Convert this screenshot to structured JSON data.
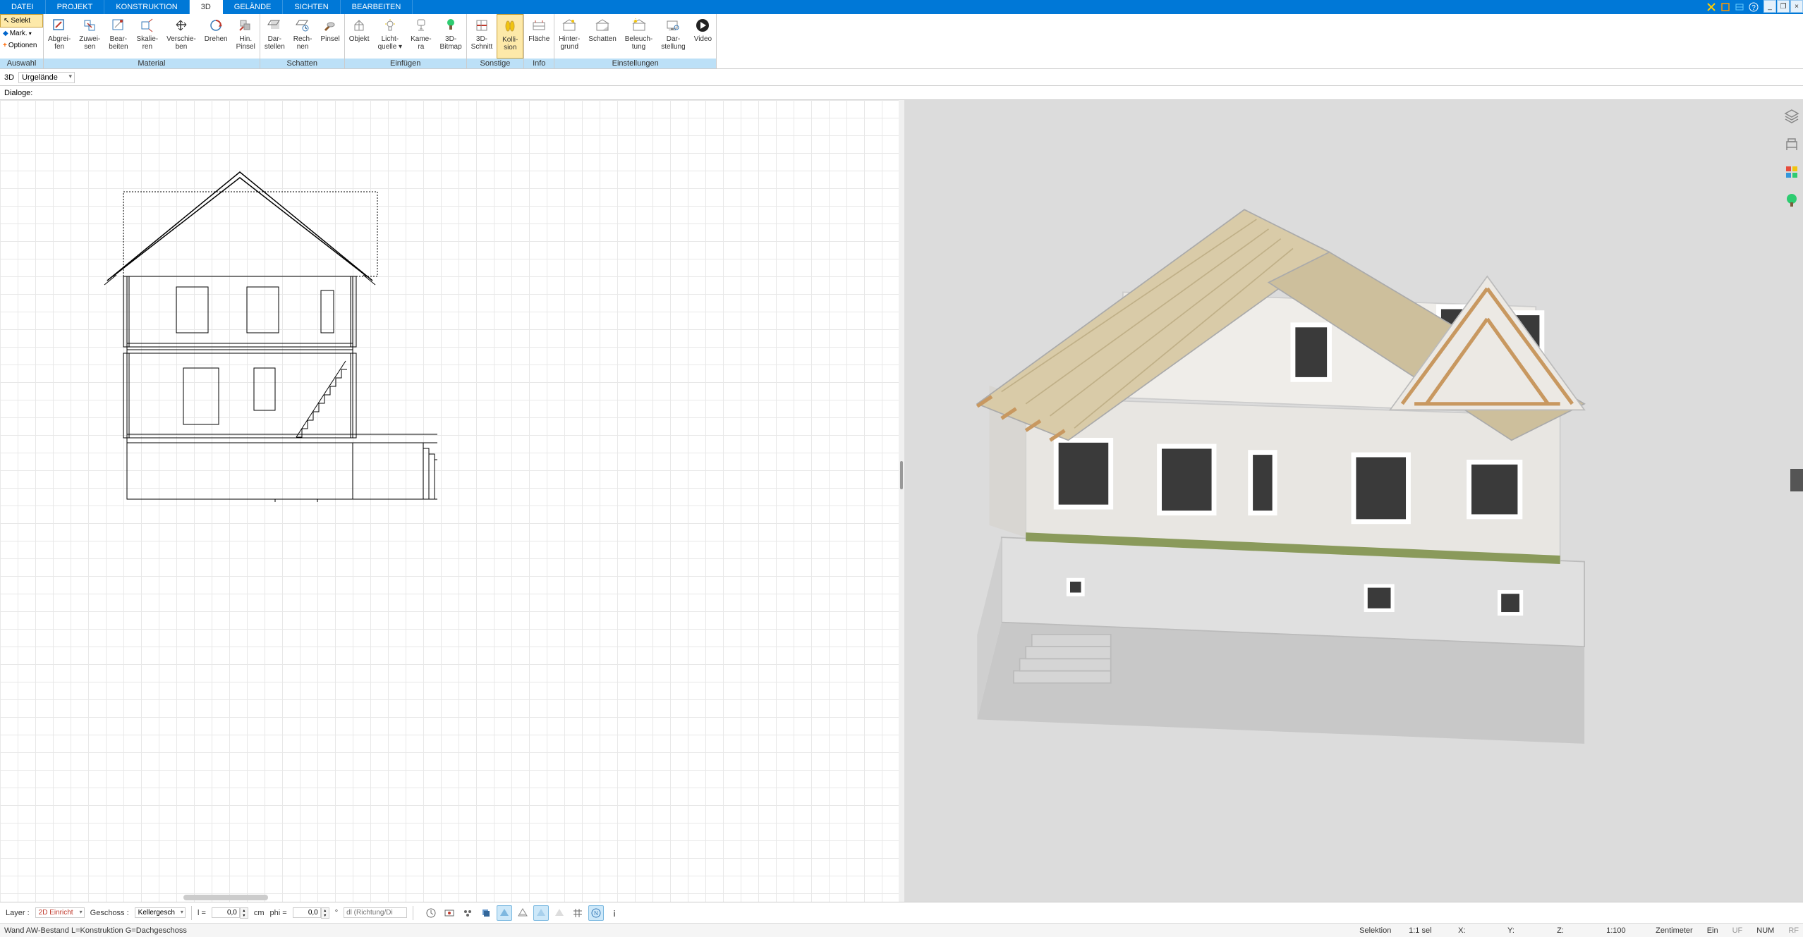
{
  "menu": {
    "items": [
      "DATEI",
      "PROJEKT",
      "KONSTRUKTION",
      "3D",
      "GELÄNDE",
      "SICHTEN",
      "BEARBEITEN"
    ],
    "active": "3D"
  },
  "ribbonLeft": {
    "selekt": "Selekt",
    "mark": "Mark.",
    "optionen": "Optionen"
  },
  "ribbon": {
    "groups": [
      {
        "label": "Auswahl",
        "buttons": []
      },
      {
        "label": "Material",
        "buttons": [
          {
            "l1": "Abgrei-",
            "l2": "fen"
          },
          {
            "l1": "Zuwei-",
            "l2": "sen"
          },
          {
            "l1": "Bear-",
            "l2": "beiten"
          },
          {
            "l1": "Skalie-",
            "l2": "ren"
          },
          {
            "l1": "Verschie-",
            "l2": "ben"
          },
          {
            "l1": "Drehen",
            "l2": ""
          },
          {
            "l1": "Hin.",
            "l2": "Pinsel"
          }
        ]
      },
      {
        "label": "Schatten",
        "buttons": [
          {
            "l1": "Dar-",
            "l2": "stellen"
          },
          {
            "l1": "Rech-",
            "l2": "nen"
          },
          {
            "l1": "Pinsel",
            "l2": ""
          }
        ]
      },
      {
        "label": "Einfügen",
        "buttons": [
          {
            "l1": "Objekt",
            "l2": ""
          },
          {
            "l1": "Licht-",
            "l2": "quelle ▾"
          },
          {
            "l1": "Kame-",
            "l2": "ra"
          },
          {
            "l1": "3D-",
            "l2": "Bitmap"
          }
        ]
      },
      {
        "label": "Sonstige",
        "buttons": [
          {
            "l1": "3D-",
            "l2": "Schnitt"
          },
          {
            "l1": "Kolli-",
            "l2": "sion",
            "active": true
          }
        ]
      },
      {
        "label": "Info",
        "buttons": [
          {
            "l1": "Fläche",
            "l2": ""
          }
        ]
      },
      {
        "label": "Einstellungen",
        "buttons": [
          {
            "l1": "Hinter-",
            "l2": "grund"
          },
          {
            "l1": "Schatten",
            "l2": ""
          },
          {
            "l1": "Beleuch-",
            "l2": "tung"
          },
          {
            "l1": "Dar-",
            "l2": "stellung"
          },
          {
            "l1": "Video",
            "l2": ""
          }
        ]
      }
    ]
  },
  "secBar": {
    "mode": "3D",
    "value": "Urgelände"
  },
  "dialoge": "Dialoge:",
  "bottom": {
    "layerLabel": "Layer :",
    "layer": "2D Einricht",
    "geschossLabel": "Geschoss :",
    "geschoss": "Kellergesch",
    "lLabel": "l =",
    "lVal": "0,0",
    "lUnit": "cm",
    "phiLabel": "phi =",
    "phiVal": "0,0",
    "phiUnit": "°",
    "dirPlaceholder": "dl (Richtung/Di"
  },
  "status": {
    "left": "Wand AW-Bestand L=Konstruktion G=Dachgeschoss",
    "sel": "Selektion",
    "ratio": "1:1 sel",
    "x": "X:",
    "y": "Y:",
    "z": "Z:",
    "scale": "1:100",
    "unit": "Zentimeter",
    "ein": "Ein",
    "uf": "UF",
    "num": "NUM",
    "rf": "RF"
  }
}
